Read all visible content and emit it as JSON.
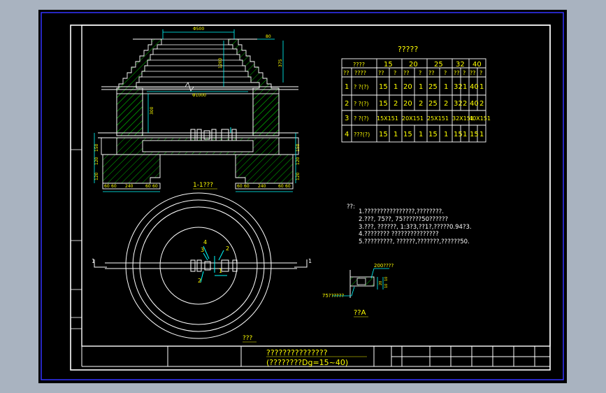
{
  "title_block": {
    "line1": "???????????????",
    "line2": "(????????Dg=15~40)"
  },
  "table": {
    "title": "?????",
    "col1_header": "????",
    "sizes": [
      "15",
      "20",
      "25",
      "32",
      "40"
    ],
    "subhead": [
      "??",
      "????",
      "??",
      "?",
      "??",
      "?",
      "??",
      "?",
      "??",
      "?",
      "??",
      "?"
    ],
    "rows": [
      {
        "no": "1",
        "name": "? ?(?)",
        "cells": [
          "15",
          "1",
          "20",
          "1",
          "25",
          "1",
          "32",
          "1",
          "40",
          "1"
        ]
      },
      {
        "no": "2",
        "name": "? ?(?)",
        "cells": [
          "15",
          "2",
          "20",
          "2",
          "25",
          "2",
          "32",
          "2",
          "40",
          "2"
        ]
      },
      {
        "no": "3",
        "name": "? ?(?)",
        "cells": [
          "15X151",
          "20X151",
          "25X151",
          "32X151",
          "40X151"
        ]
      },
      {
        "no": "4",
        "name": "???(?)",
        "cells": [
          "15",
          "1",
          "15",
          "1",
          "15",
          "1",
          "15",
          "1",
          "15",
          "1"
        ]
      }
    ]
  },
  "notes": {
    "heading": "??:",
    "lines": [
      "1.????????????????,????????.",
      "2.???, 75??, 75??????50??????",
      "3.???, ??????, 1:3?3,??1?,?????0.94?3.",
      "4.???????? ???????????????",
      "5.?????????, ??????,???????,??????50."
    ]
  },
  "section": {
    "title": "1-1???",
    "dim_top": "Φ500",
    "dim_mid": "Φ1000",
    "dim_height": "1200",
    "dim_300": "300",
    "dim_375": "375",
    "dim_80": "80",
    "dim_150": "150",
    "dim_120a": "120",
    "dim_120b": "120",
    "base_dims": [
      "60",
      "60",
      "240",
      "60",
      "60"
    ]
  },
  "plan": {
    "title": "???",
    "cut_left": "1",
    "cut_right": "1",
    "labels": {
      "a": "4",
      "b": "3",
      "c": "2",
      "d": "1",
      "e": "2"
    }
  },
  "detail": {
    "title": "??A",
    "label_top": "200????",
    "label_left": "75??????",
    "dims": [
      "20",
      "10",
      "10"
    ]
  },
  "colors": {
    "background": "#000000",
    "border": "#ffffff",
    "text": "#ffff00",
    "hatch": "#00c800",
    "dimension": "#00ffff",
    "pipe": "#ffffff",
    "outer_frame": "#3333ff"
  }
}
